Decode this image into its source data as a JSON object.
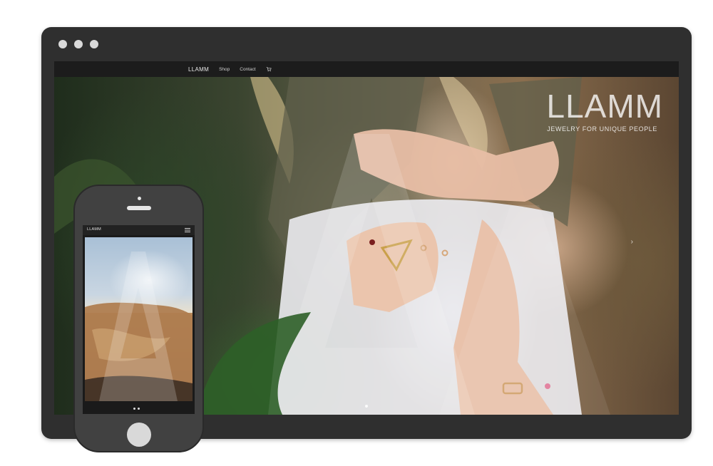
{
  "desktop": {
    "nav": {
      "logo": "LLAMM",
      "links": [
        "Shop",
        "Contact"
      ],
      "cart_icon": "cart-icon"
    },
    "hero": {
      "title": "LLAMM",
      "tagline": "JEWELRY FOR UNIQUE PEOPLE",
      "next_arrow": "›"
    }
  },
  "phone": {
    "nav": {
      "logo": "LLAMM",
      "menu_icon": "hamburger-icon"
    }
  },
  "colors": {
    "frame": "#2f2f2f",
    "window_dots": "#d9d9d9",
    "phone_body": "#414141"
  }
}
